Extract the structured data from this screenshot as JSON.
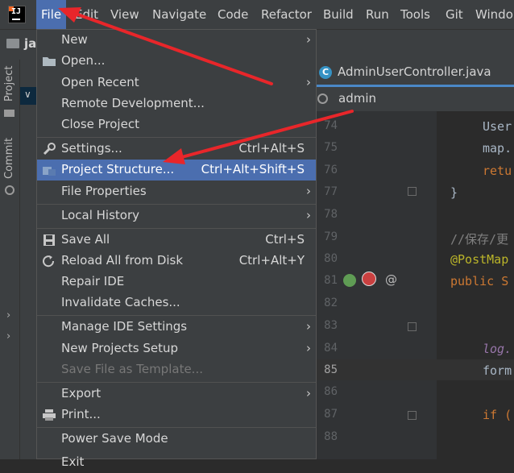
{
  "menubar": {
    "logo_text": "IJ",
    "items": [
      "File",
      "Edit",
      "View",
      "Navigate",
      "Code",
      "Refactor",
      "Build",
      "Run",
      "Tools",
      "Git",
      "Windo"
    ]
  },
  "project_label": "ja",
  "side_tabs": [
    "Project",
    "Commit"
  ],
  "file_menu": [
    {
      "label": "New",
      "arrow": true
    },
    {
      "label": "Open...",
      "icon": "folder-icon"
    },
    {
      "label": "Open Recent",
      "arrow": true
    },
    {
      "label": "Remote Development..."
    },
    {
      "label": "Close Project"
    },
    {
      "label": "Settings...",
      "shortcut": "Ctrl+Alt+S",
      "icon": "wrench-icon"
    },
    {
      "label": "Project Structure...",
      "shortcut": "Ctrl+Alt+Shift+S",
      "icon": "project-structure-icon",
      "selected": true
    },
    {
      "label": "File Properties",
      "arrow": true
    },
    {
      "label": "Local History",
      "arrow": true
    },
    {
      "label": "Save All",
      "shortcut": "Ctrl+S",
      "icon": "save-icon"
    },
    {
      "label": "Reload All from Disk",
      "shortcut": "Ctrl+Alt+Y",
      "icon": "reload-icon"
    },
    {
      "label": "Repair IDE"
    },
    {
      "label": "Invalidate Caches..."
    },
    {
      "label": "Manage IDE Settings",
      "arrow": true
    },
    {
      "label": "New Projects Setup",
      "arrow": true
    },
    {
      "label": "Save File as Template...",
      "disabled": true
    },
    {
      "label": "Export",
      "arrow": true
    },
    {
      "label": "Print...",
      "icon": "print-icon"
    },
    {
      "label": "Power Save Mode"
    },
    {
      "label": "Exit"
    }
  ],
  "editor": {
    "tab_title": "AdminUserController.java",
    "tab_icon_letter": "C",
    "search_value": "admin",
    "line_numbers": [
      "74",
      "75",
      "76",
      "77",
      "78",
      "79",
      "80",
      "81",
      "82",
      "83",
      "84",
      "85",
      "86",
      "87",
      "88"
    ],
    "current_line": "85",
    "code_lines": [
      {
        "text": "User",
        "color": "#a9b7c6"
      },
      {
        "text": "map.",
        "color": "#a9b7c6"
      },
      {
        "text": "retu",
        "color": "#cc7832"
      },
      {
        "text": "}",
        "color": "#a9b7c6"
      },
      {
        "text": "",
        "color": "#a9b7c6"
      },
      {
        "text": "//保存/更",
        "color": "#808080"
      },
      {
        "text": "@PostMap",
        "color": "#bbb529"
      },
      {
        "text": "public S",
        "color": "#cc7832"
      },
      {
        "text": "",
        "color": "#a9b7c6"
      },
      {
        "text": "",
        "color": "#a9b7c6"
      },
      {
        "text": "log.",
        "color": "#9876aa"
      },
      {
        "text": "form",
        "color": "#a9b7c6"
      },
      {
        "text": "",
        "color": "#a9b7c6"
      },
      {
        "text": "if (",
        "color": "#cc7832"
      },
      {
        "text": "",
        "color": "#a9b7c6"
      }
    ],
    "gutter_at": "@"
  },
  "colors": {
    "accent": "#4b6eaf",
    "annotation_red": "#e8262a",
    "tab_underline": "#4a88c7"
  }
}
